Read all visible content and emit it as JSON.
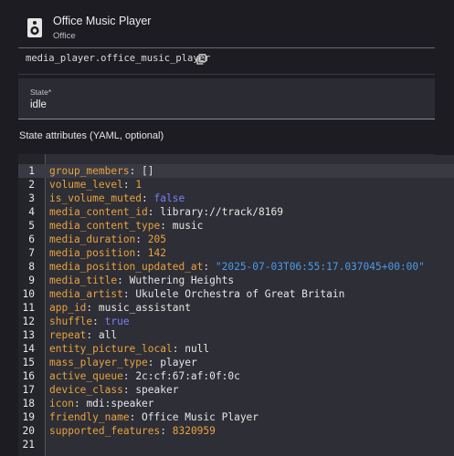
{
  "entity": {
    "name": "Office Music Player",
    "area": "Office",
    "entity_id": "media_player.office_music_player",
    "icon": "speaker-icon"
  },
  "state_field": {
    "label": "State*",
    "value": "idle"
  },
  "attributes": {
    "heading": "State attributes (YAML, optional)",
    "lines": [
      {
        "n": "1",
        "key": "group_members",
        "val": "[]",
        "type": "p"
      },
      {
        "n": "2",
        "key": "volume_level",
        "val": "1",
        "type": "num"
      },
      {
        "n": "3",
        "key": "is_volume_muted",
        "val": "false",
        "type": "bool"
      },
      {
        "n": "4",
        "key": "media_content_id",
        "val": "library://track/8169",
        "type": "plain"
      },
      {
        "n": "5",
        "key": "media_content_type",
        "val": "music",
        "type": "plain"
      },
      {
        "n": "6",
        "key": "media_duration",
        "val": "205",
        "type": "num"
      },
      {
        "n": "7",
        "key": "media_position",
        "val": "142",
        "type": "num"
      },
      {
        "n": "8",
        "key": "media_position_updated_at",
        "val": "\"2025-07-03T06:55:17.037045+00:00\"",
        "type": "str"
      },
      {
        "n": "9",
        "key": "media_title",
        "val": "Wuthering Heights",
        "type": "plain"
      },
      {
        "n": "10",
        "key": "media_artist",
        "val": "Ukulele Orchestra of Great Britain",
        "type": "plain"
      },
      {
        "n": "11",
        "key": "app_id",
        "val": "music_assistant",
        "type": "plain"
      },
      {
        "n": "12",
        "key": "shuffle",
        "val": "true",
        "type": "bool"
      },
      {
        "n": "13",
        "key": "repeat",
        "val": "all",
        "type": "plain"
      },
      {
        "n": "14",
        "key": "entity_picture_local",
        "val": "null",
        "type": "plain"
      },
      {
        "n": "15",
        "key": "mass_player_type",
        "val": "player",
        "type": "plain"
      },
      {
        "n": "16",
        "key": "active_queue",
        "val": "2c:cf:67:af:0f:0c",
        "type": "plain"
      },
      {
        "n": "17",
        "key": "device_class",
        "val": "speaker",
        "type": "plain"
      },
      {
        "n": "18",
        "key": "icon",
        "val": "mdi:speaker",
        "type": "plain"
      },
      {
        "n": "19",
        "key": "friendly_name",
        "val": "Office Music Player",
        "type": "plain"
      },
      {
        "n": "20",
        "key": "supported_features",
        "val": "8320959",
        "type": "num"
      },
      {
        "n": "21",
        "key": "",
        "val": "",
        "type": "plain"
      }
    ]
  },
  "colors": {
    "key": "#e8a33d",
    "number": "#e8a33d",
    "boolean": "#7b7ff7",
    "string": "#4a9be8"
  }
}
